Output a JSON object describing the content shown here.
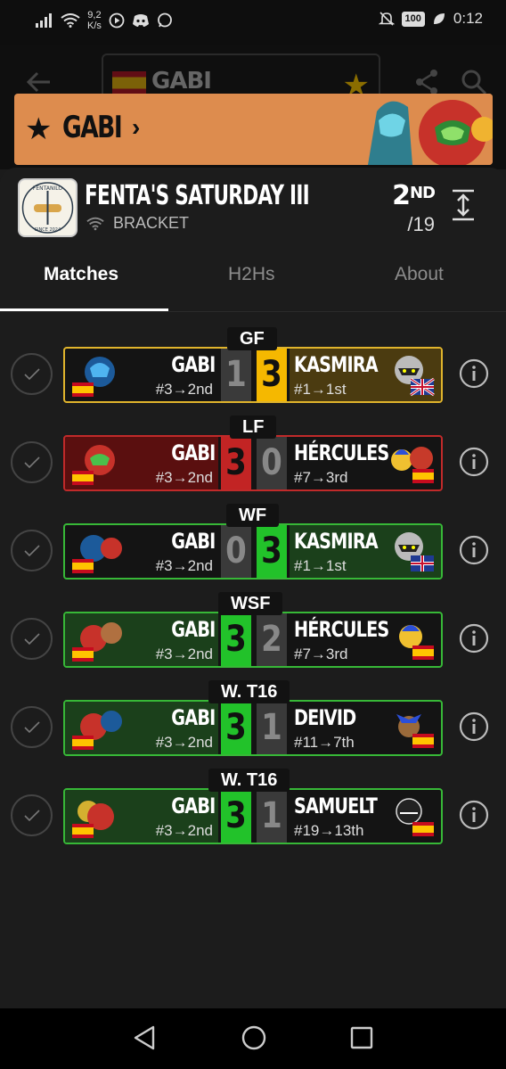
{
  "status_bar": {
    "net_speed_value": "9,2",
    "net_speed_unit": "K/s",
    "battery": "100",
    "time": "0:12"
  },
  "top_bar": {
    "player_chip_name": "GABI"
  },
  "banner": {
    "name": "GABI"
  },
  "tournament": {
    "title": "FENTA'S SATURDAY III",
    "type": "BRACKET",
    "placement": "2",
    "placement_suffix": "ND",
    "entrants": "/19",
    "logo_text_top": "FENTANILO",
    "logo_text_bottom": "SINCE 2024"
  },
  "tabs": [
    "Matches",
    "H2Hs",
    "About"
  ],
  "matches": [
    {
      "round": "GF",
      "p1": "GABI",
      "p1_seed": "#3→2nd",
      "s1": "1",
      "s2": "3",
      "p2": "KASMIRA",
      "p2_seed": "#1→1st"
    },
    {
      "round": "LF",
      "p1": "GABI",
      "p1_seed": "#3→2nd",
      "s1": "3",
      "s2": "0",
      "p2": "HÉRCULES",
      "p2_seed": "#7→3rd"
    },
    {
      "round": "WF",
      "p1": "GABI",
      "p1_seed": "#3→2nd",
      "s1": "0",
      "s2": "3",
      "p2": "KASMIRA",
      "p2_seed": "#1→1st"
    },
    {
      "round": "WSF",
      "p1": "GABI",
      "p1_seed": "#3→2nd",
      "s1": "3",
      "s2": "2",
      "p2": "HÉRCULES",
      "p2_seed": "#7→3rd"
    },
    {
      "round": "W. T16",
      "p1": "GABI",
      "p1_seed": "#3→2nd",
      "s1": "3",
      "s2": "1",
      "p2": "DEIVID",
      "p2_seed": "#11→7th"
    },
    {
      "round": "W. T16",
      "p1": "GABI",
      "p1_seed": "#3→2nd",
      "s1": "3",
      "s2": "1",
      "p2": "SAMUELT",
      "p2_seed": "#19→13th"
    }
  ],
  "colors": {
    "win": "#22c22a",
    "loss": "#c22424",
    "champion": "#f5b800",
    "banner": "#dd8c4e"
  },
  "icons": [
    "wifi-icon",
    "discord-icon",
    "whatsapp-icon",
    "mute-icon",
    "leaf-icon",
    "back-arrow-icon",
    "star-icon",
    "share-icon",
    "search-icon",
    "expand-icon",
    "check-icon",
    "info-icon",
    "spain-flag-icon",
    "uk-flag-icon"
  ]
}
